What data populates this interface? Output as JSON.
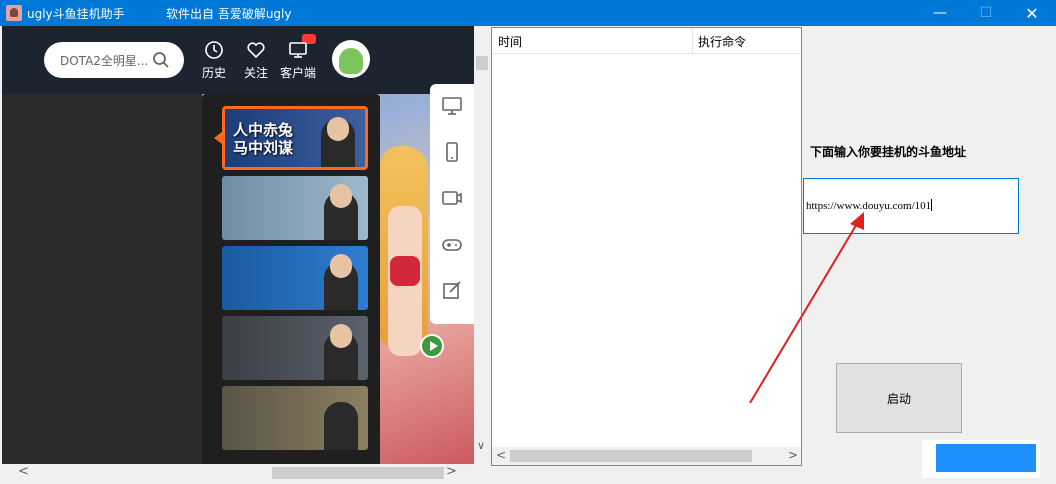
{
  "window": {
    "title": "ugly斗鱼挂机助手",
    "subtitle": "软件出自 吾爱破解ugly",
    "controls": {
      "minimize": "—",
      "maximize": "☐",
      "close": "✕"
    }
  },
  "web": {
    "search_placeholder": "DOTA2全明星...",
    "header": {
      "history": "历史",
      "follow": "关注",
      "client": "客户端"
    },
    "thumbnails": [
      {
        "text": "人中赤兔\n马中刘谋"
      },
      {
        "text": ""
      },
      {
        "text": ""
      },
      {
        "text": ""
      },
      {
        "text": ""
      }
    ]
  },
  "log": {
    "columns": [
      "时间",
      "执行命令"
    ],
    "rows": []
  },
  "form": {
    "label": "下面输入你要挂机的斗鱼地址",
    "url_value": "https://www.douyu.com/101",
    "start_button": "启动"
  },
  "colors": {
    "titlebar": "#0078d7",
    "accent_border": "#ff6a1a",
    "arrow": "#e02020"
  }
}
